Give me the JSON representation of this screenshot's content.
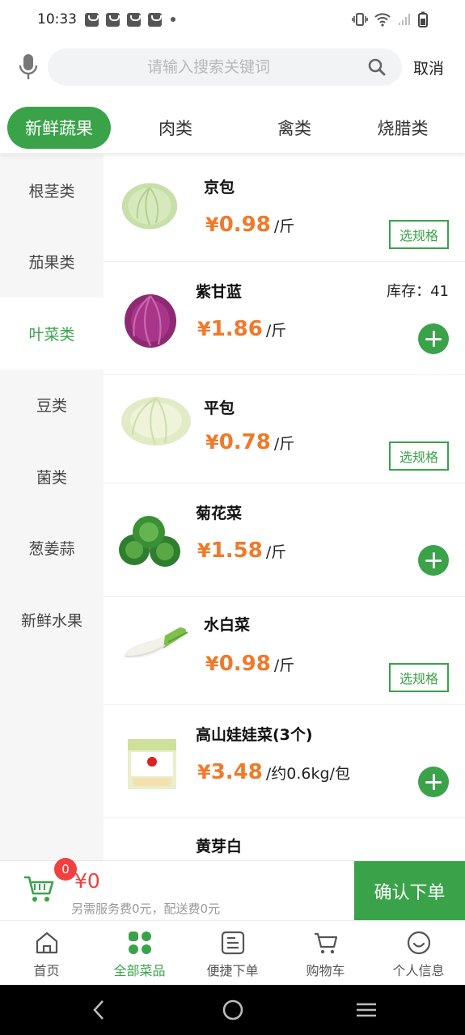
{
  "status": {
    "time": "10:33"
  },
  "search": {
    "placeholder": "请输入搜索关键词",
    "value": "",
    "cancel_label": "取消"
  },
  "categories": [
    {
      "label": "新鲜蔬果",
      "active": true
    },
    {
      "label": "肉类",
      "active": false
    },
    {
      "label": "禽类",
      "active": false
    },
    {
      "label": "烧腊类",
      "active": false
    }
  ],
  "sidebar": {
    "items": [
      {
        "label": "根茎类",
        "active": false
      },
      {
        "label": "茄果类",
        "active": false
      },
      {
        "label": "叶菜类",
        "active": true
      },
      {
        "label": "豆类",
        "active": false
      },
      {
        "label": "菌类",
        "active": false
      },
      {
        "label": "葱姜蒜",
        "active": false
      },
      {
        "label": "新鲜水果",
        "active": false
      }
    ]
  },
  "products": [
    {
      "name": "京包",
      "yen": "¥",
      "price": "0.98",
      "unit": "/斤",
      "action": "spec",
      "action_label": "选规格",
      "stock": "",
      "image": "cabbage-green"
    },
    {
      "name": "紫甘蓝",
      "yen": "¥",
      "price": "1.86",
      "unit": "/斤",
      "action": "add",
      "action_label": "",
      "stock": "库存：41",
      "image": "cabbage-purple"
    },
    {
      "name": "平包",
      "yen": "¥",
      "price": "0.78",
      "unit": "/斤",
      "action": "spec",
      "action_label": "选规格",
      "stock": "",
      "image": "cabbage-flat"
    },
    {
      "name": "菊花菜",
      "yen": "¥",
      "price": "1.58",
      "unit": "/斤",
      "action": "add",
      "action_label": "",
      "stock": "",
      "image": "chrysanthemum-greens"
    },
    {
      "name": "水白菜",
      "yen": "¥",
      "price": "0.98",
      "unit": "/斤",
      "action": "spec",
      "action_label": "选规格",
      "stock": "",
      "image": "bok-choy"
    },
    {
      "name": "高山娃娃菜(3个)",
      "yen": "¥",
      "price": "3.48",
      "unit": "/约0.6kg/包",
      "action": "add",
      "action_label": "",
      "stock": "",
      "image": "baby-cabbage-pack"
    },
    {
      "name": "黄芽白",
      "yen": "",
      "price": "",
      "unit": "",
      "action": "none",
      "action_label": "",
      "stock": "",
      "image": "napa-cabbage"
    }
  ],
  "cart": {
    "count": "0",
    "total": "¥0",
    "fee_text": "另需服务费0元，配送费0元",
    "confirm_label": "确认下单"
  },
  "nav": {
    "items": [
      {
        "label": "首页",
        "icon": "home-icon",
        "active": false
      },
      {
        "label": "全部菜品",
        "icon": "grid-icon",
        "active": true
      },
      {
        "label": "便捷下单",
        "icon": "quick-order-icon",
        "active": false
      },
      {
        "label": "购物车",
        "icon": "cart-icon",
        "active": false
      },
      {
        "label": "个人信息",
        "icon": "profile-icon",
        "active": false
      }
    ]
  },
  "colors": {
    "accent": "#3aa34a",
    "price": "#f07a2a",
    "badge": "#f04040"
  }
}
